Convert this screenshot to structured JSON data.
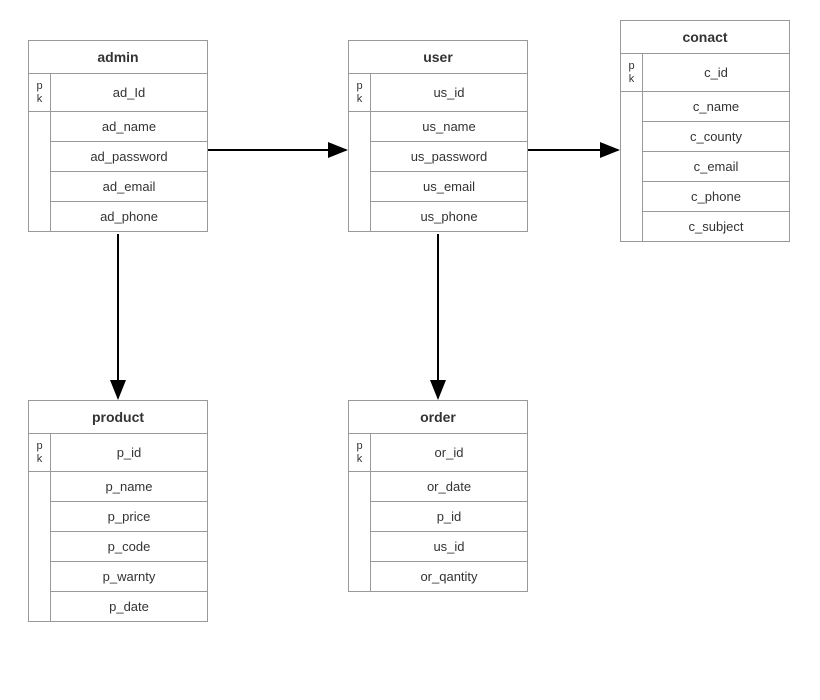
{
  "entities": {
    "admin": {
      "title": "admin",
      "pk_label": "p\nk",
      "pk_attr": "ad_Id",
      "attrs": [
        "ad_name",
        "ad_password",
        "ad_email",
        "ad_phone"
      ]
    },
    "user": {
      "title": "user",
      "pk_label": "p\nk",
      "pk_attr": "us_id",
      "attrs": [
        "us_name",
        "us_password",
        "us_email",
        "us_phone"
      ]
    },
    "conact": {
      "title": "conact",
      "pk_label": "p\nk",
      "pk_attr": "c_id",
      "attrs": [
        "c_name",
        "c_county",
        "c_email",
        "c_phone",
        "c_subject"
      ]
    },
    "product": {
      "title": "product",
      "pk_label": "p\nk",
      "pk_attr": "p_id",
      "attrs": [
        "p_name",
        "p_price",
        "p_code",
        "p_warnty",
        "p_date"
      ]
    },
    "order": {
      "title": "order",
      "pk_label": "p\nk",
      "pk_attr": "or_id",
      "attrs": [
        "or_date",
        "p_id",
        "us_id",
        "or_qantity"
      ]
    }
  },
  "relationships": [
    {
      "from": "admin",
      "to": "user"
    },
    {
      "from": "user",
      "to": "conact"
    },
    {
      "from": "admin",
      "to": "product"
    },
    {
      "from": "user",
      "to": "order"
    }
  ]
}
